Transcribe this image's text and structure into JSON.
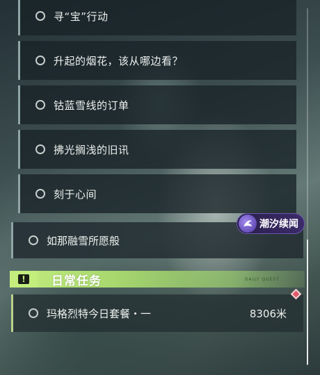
{
  "quests": [
    {
      "label": "寻“宝”行动"
    },
    {
      "label": "升起的烟花，该从哪边看？"
    },
    {
      "label": "钴蓝雪线的订单"
    },
    {
      "label": "拂光搁浅的旧讯"
    },
    {
      "label": "刻于心间"
    }
  ],
  "main_quest": {
    "label": "如那融雪所愿般"
  },
  "event_tag": {
    "label": "潮汐续闻",
    "icon": "tide-emblem-icon"
  },
  "daily": {
    "header": "日常任务",
    "alert_symbol": "!",
    "header_small_text": "DAILY QUEST",
    "quest": {
      "label": "玛格烈特今日套餐・一",
      "distance": "8306米"
    }
  },
  "colors": {
    "accent_green": "#c3ee7e",
    "event_purple": "#4a34a0",
    "marker_red": "#e05a6a"
  }
}
